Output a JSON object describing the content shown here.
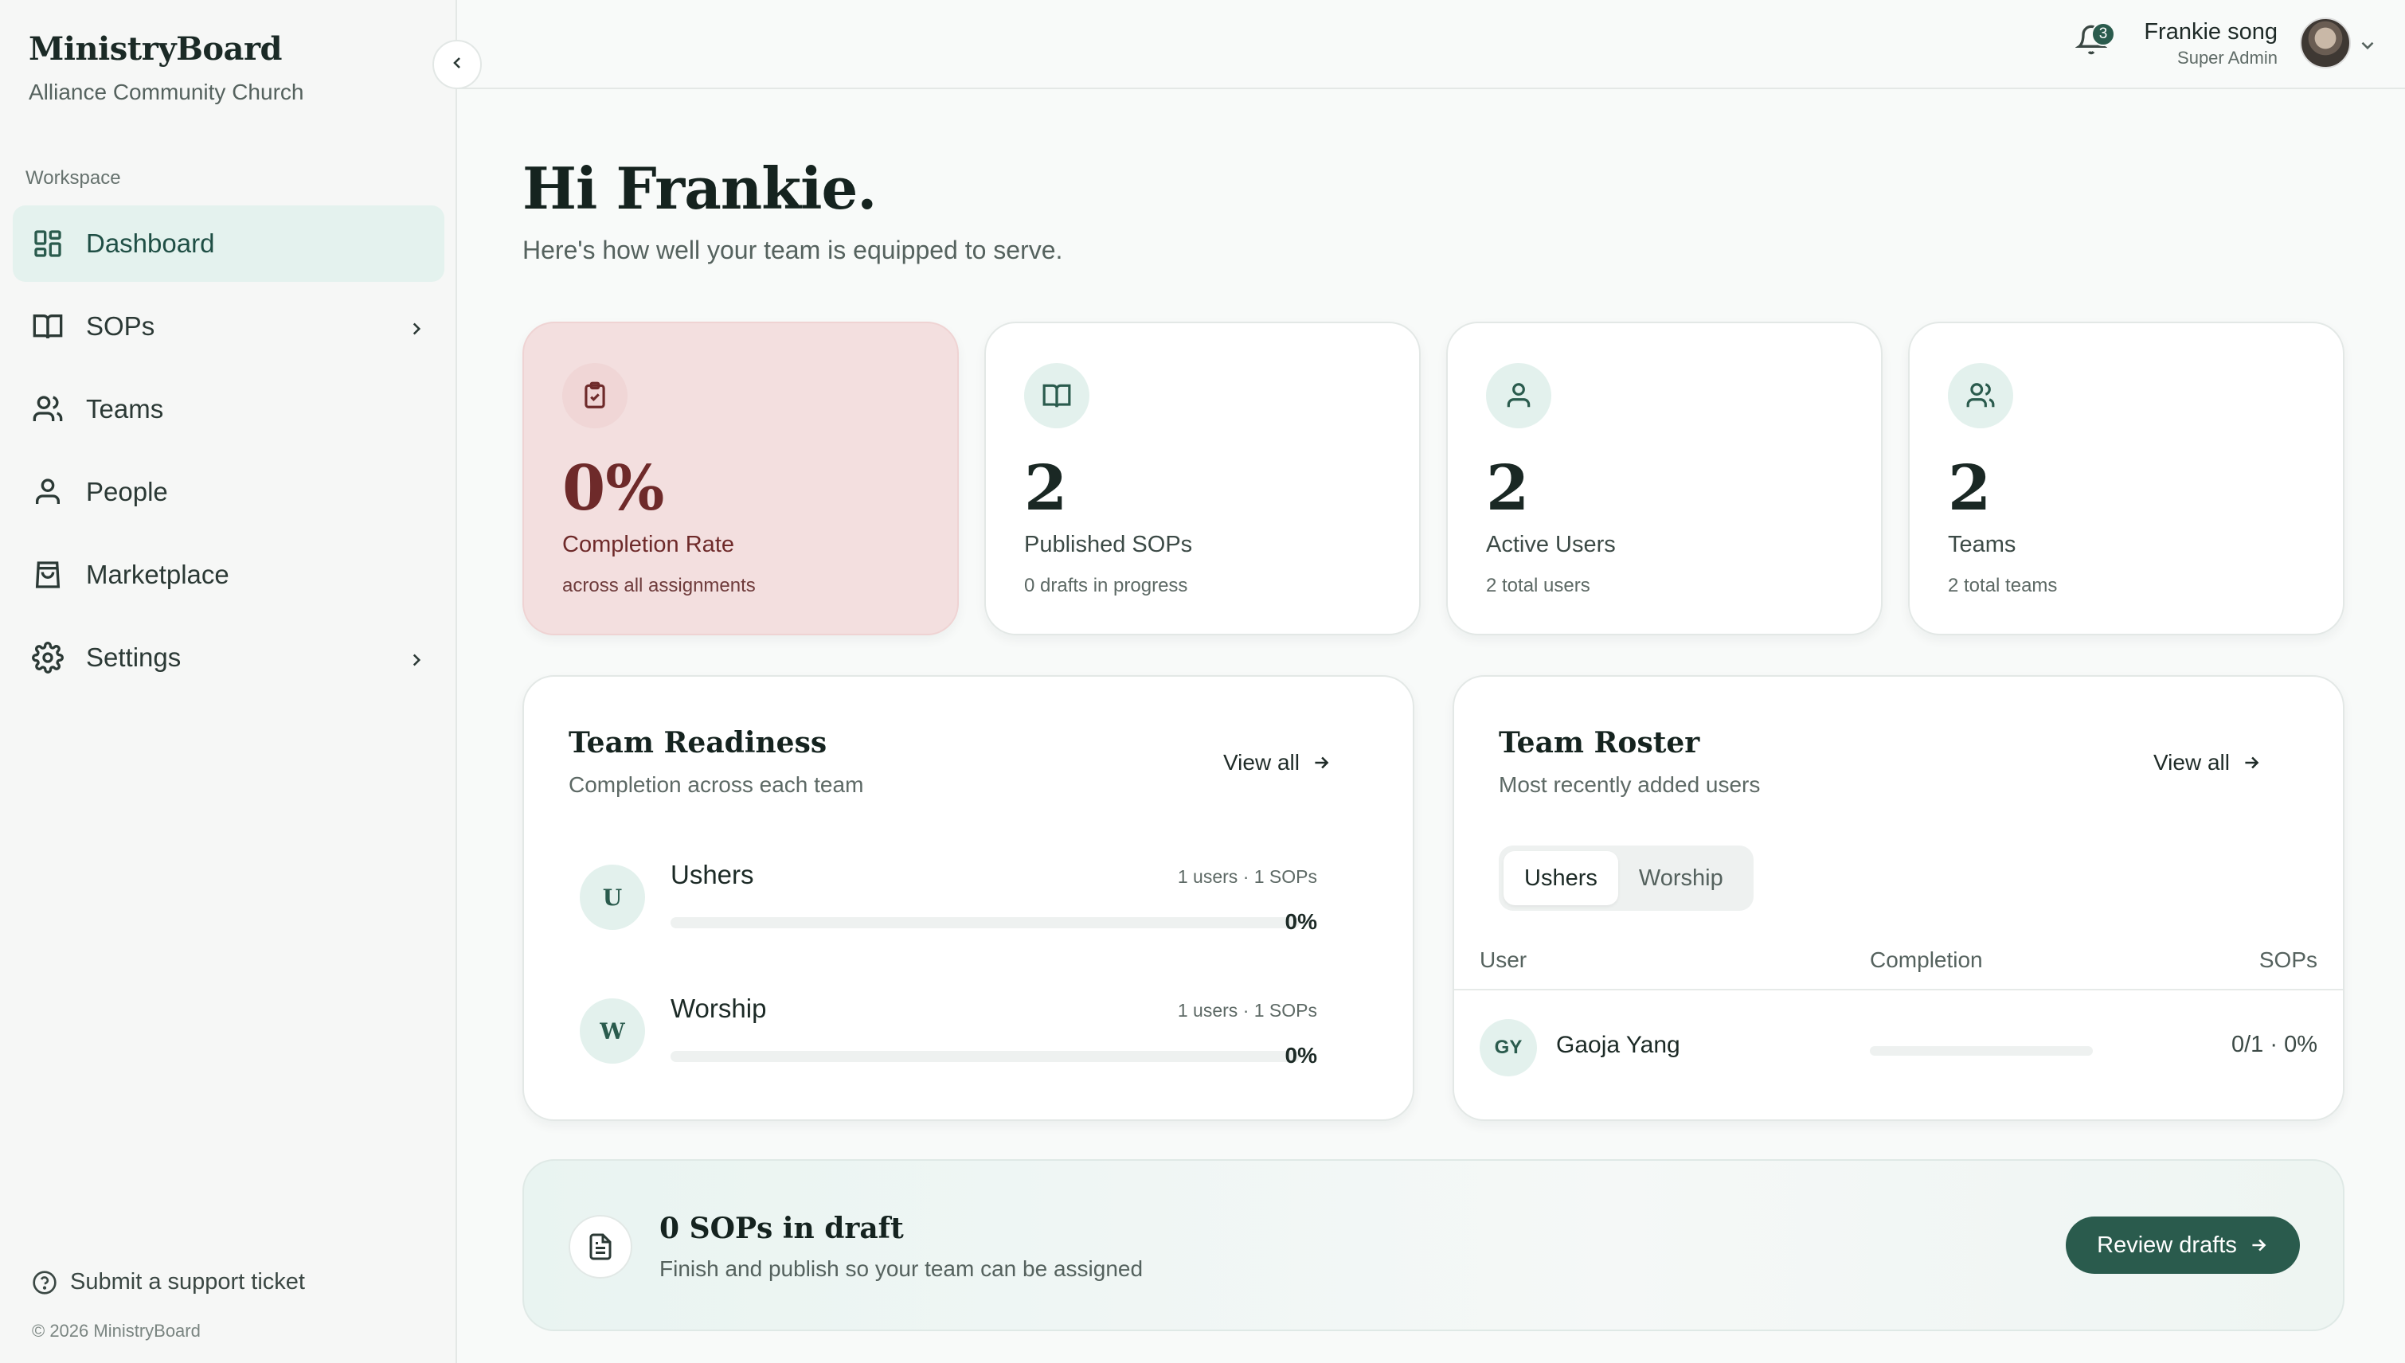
{
  "sidebar": {
    "brand": "MinistryBoard",
    "org": "Alliance Community Church",
    "section_label": "Workspace",
    "items": [
      {
        "label": "Dashboard",
        "icon": "dashboard-grid-icon",
        "active": true,
        "has_submenu": false
      },
      {
        "label": "SOPs",
        "icon": "book-icon",
        "active": false,
        "has_submenu": true
      },
      {
        "label": "Teams",
        "icon": "users-icon",
        "active": false,
        "has_submenu": false
      },
      {
        "label": "People",
        "icon": "user-icon",
        "active": false,
        "has_submenu": false
      },
      {
        "label": "Marketplace",
        "icon": "shopping-bag-icon",
        "active": false,
        "has_submenu": false
      },
      {
        "label": "Settings",
        "icon": "gear-icon",
        "active": false,
        "has_submenu": true
      }
    ],
    "support_label": "Submit a support ticket",
    "copyright": "© 2026 MinistryBoard"
  },
  "topbar": {
    "notification_count": "3",
    "user_name": "Frankie song",
    "user_role": "Super Admin"
  },
  "main": {
    "greeting": "Hi Frankie.",
    "subtitle": "Here's how well your team is equipped to serve.",
    "stats": [
      {
        "value": "0%",
        "label": "Completion Rate",
        "sub": "across all assignments",
        "icon": "clipboard-check-icon"
      },
      {
        "value": "2",
        "label": "Published SOPs",
        "sub": "0 drafts in progress",
        "icon": "book-icon"
      },
      {
        "value": "2",
        "label": "Active Users",
        "sub": "2 total users",
        "icon": "user-icon"
      },
      {
        "value": "2",
        "label": "Teams",
        "sub": "2 total teams",
        "icon": "users-icon"
      }
    ],
    "team_readiness": {
      "title": "Team Readiness",
      "subtitle": "Completion across each team",
      "view_all": "View all",
      "teams": [
        {
          "initial": "U",
          "name": "Ushers",
          "meta": "1 users · 1 SOPs",
          "percent": "0%",
          "progress": 0
        },
        {
          "initial": "W",
          "name": "Worship",
          "meta": "1 users · 1 SOPs",
          "percent": "0%",
          "progress": 0
        }
      ]
    },
    "team_roster": {
      "title": "Team Roster",
      "subtitle": "Most recently added users",
      "view_all": "View all",
      "tabs": [
        {
          "label": "Ushers",
          "active": true
        },
        {
          "label": "Worship",
          "active": false
        }
      ],
      "columns": {
        "user": "User",
        "completion": "Completion",
        "sops": "SOPs"
      },
      "rows": [
        {
          "initials": "GY",
          "name": "Gaoja Yang",
          "progress": 0,
          "sops": "0/1 · 0%"
        }
      ]
    },
    "drafts": {
      "title": "0 SOPs in draft",
      "subtitle": "Finish and publish so your team can be assigned",
      "button": "Review drafts"
    }
  },
  "colors": {
    "accent": "#2a5b4d",
    "active_nav_bg": "#e4f2ee",
    "alert_card_bg": "#f3dfdf"
  }
}
